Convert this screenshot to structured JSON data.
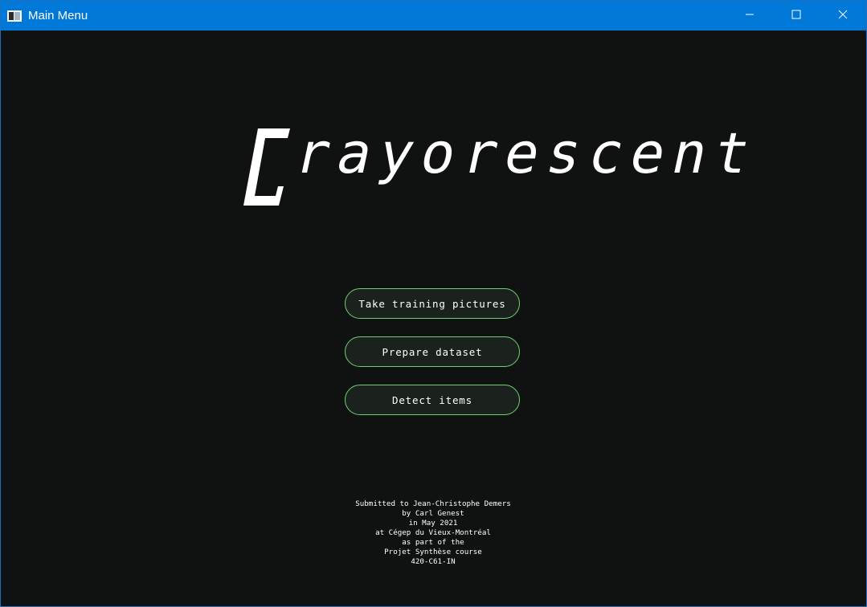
{
  "window": {
    "title": "Main Menu",
    "icons": {
      "app": "app-window-icon",
      "minimize": "minimize-icon",
      "maximize": "maximize-icon",
      "close": "close-icon"
    }
  },
  "logo": {
    "initial": "C",
    "rest": "rayorescent"
  },
  "menu": {
    "buttons": [
      {
        "label": "Take training pictures"
      },
      {
        "label": "Prepare dataset"
      },
      {
        "label": "Detect items"
      }
    ]
  },
  "credits": {
    "lines": [
      "Submitted to Jean-Christophe Demers",
      "by Carl Genest",
      "in May 2021",
      "at Cégep du Vieux-Montréal",
      "as part of the",
      "Projet Synthèse course",
      "420-C61-IN"
    ]
  },
  "colors": {
    "titlebar": "#0078d7",
    "background": "#0f1210",
    "button_border": "#6fcf6f",
    "button_fill": "#1b221d",
    "text": "#ffffff"
  }
}
